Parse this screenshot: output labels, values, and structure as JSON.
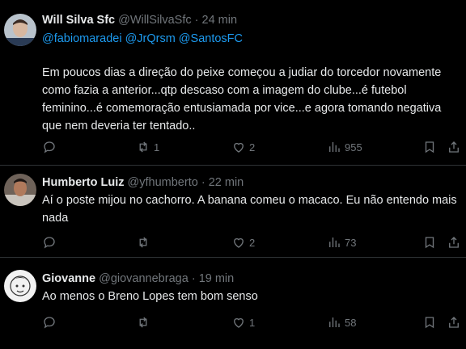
{
  "tweets": [
    {
      "author": "Will Silva Sfc",
      "handle": "@WillSilvaSfc",
      "time": "24 min",
      "mentions": [
        "@fabiomaradei",
        "@JrQrsm",
        "@SantosFC"
      ],
      "text": "Em poucos dias a direção do peixe começou a judiar do torcedor novamente como fazia a anterior...qtp descaso com a imagem do clube...é futebol feminino...é comemoração entusiamada por vice...e agora tomando negativa que nem deveria ter tentado..",
      "replies": "",
      "retweets": "1",
      "likes": "2",
      "views": "955"
    },
    {
      "author": "Humberto Luiz",
      "handle": "@yfhumberto",
      "time": "22 min",
      "text": "Aí o poste mijou no cachorro. A banana comeu o macaco. Eu não entendo mais nada",
      "replies": "",
      "retweets": "",
      "likes": "2",
      "views": "73"
    },
    {
      "author": "Giovanne",
      "handle": "@giovannebraga",
      "time": "19 min",
      "text": "Ao menos o Breno Lopes tem bom senso",
      "replies": "",
      "retweets": "",
      "likes": "1",
      "views": "58"
    }
  ],
  "separator": "·",
  "icons": [
    "reply-icon",
    "retweet-icon",
    "like-icon",
    "views-icon",
    "bookmark-icon",
    "share-icon"
  ]
}
